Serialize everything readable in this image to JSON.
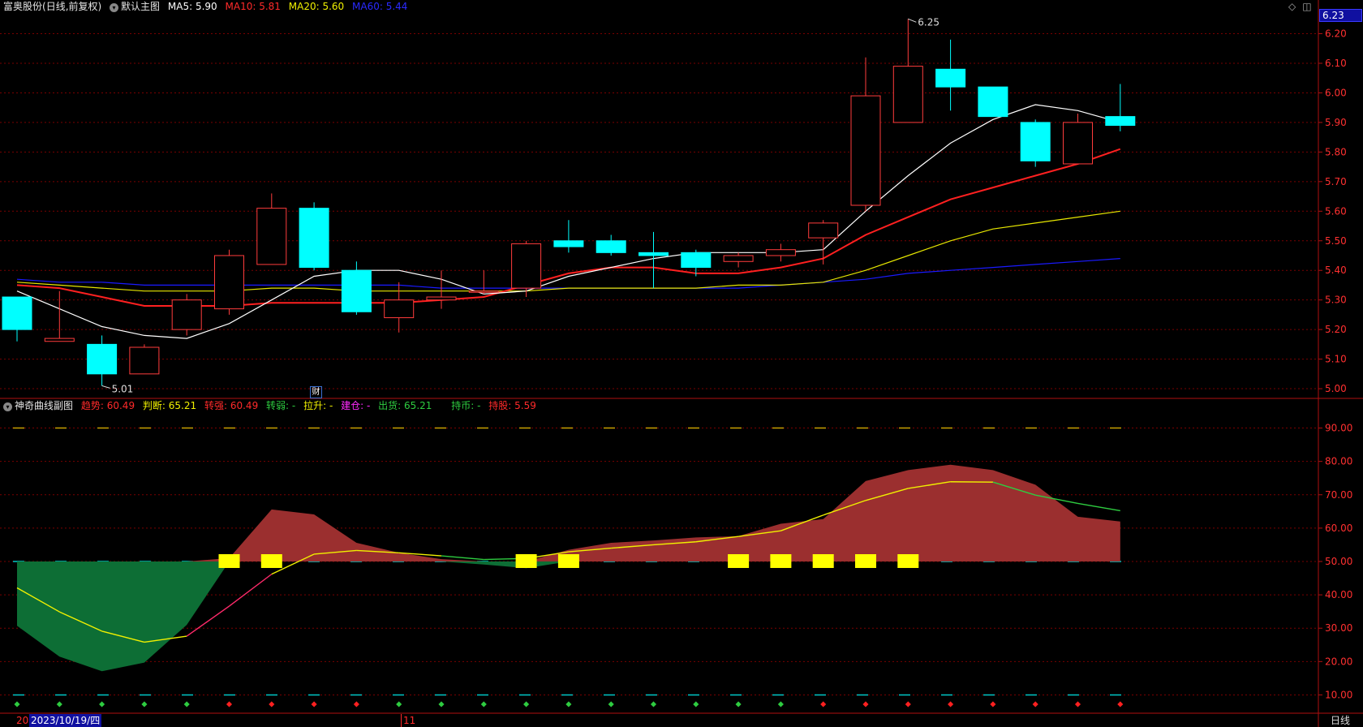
{
  "main_header": {
    "stock": "富奥股份",
    "period": "(日线,前复权)",
    "template": "默认主图",
    "ma5_label": "MA5:",
    "ma5_value": "5.90",
    "ma10_label": "MA10:",
    "ma10_value": "5.81",
    "ma20_label": "MA20:",
    "ma20_value": "5.60",
    "ma60_label": "MA60:",
    "ma60_value": "5.44"
  },
  "sub_header": {
    "title": "神奇曲线副图",
    "trend_label": "趋势:",
    "trend_value": "60.49",
    "judge_label": "判断:",
    "judge_value": "65.21",
    "strong_label": "转强:",
    "strong_value": "60.49",
    "weak_label": "转弱:",
    "weak_value": "-",
    "pull_label": "拉升:",
    "pull_value": "-",
    "build_label": "建仓:",
    "build_value": "-",
    "ship_label": "出货:",
    "ship_value": "65.21",
    "hold_label": "持币:",
    "hold_value": "-",
    "holdstock_label": "持股:",
    "holdstock_value": "5.59"
  },
  "colors": {
    "up": "#ff3c3c",
    "down": "#00ffff",
    "ma5": "#ffffff",
    "ma10": "#ff2020",
    "ma20": "#e6e600",
    "ma60": "#1a1aff",
    "grid": "#8b0000",
    "area_up": "#9b2f2f",
    "area_down": "#0d6e35",
    "marker": "#ffff00"
  },
  "current_price_tag": "6.23",
  "finance_mark": "财",
  "bottom_bar": {
    "year_frag": "20",
    "date": "2023/10/19/四",
    "month": "11",
    "period_button": "日线"
  },
  "chart_data": [
    {
      "type": "candlestick",
      "title": "富奥股份 日线",
      "x": [
        "d1",
        "d2",
        "d3",
        "d4",
        "d5",
        "d6",
        "d7",
        "d8",
        "d9",
        "d10",
        "d11",
        "d12",
        "d13",
        "d14",
        "d15",
        "d16",
        "d17",
        "d18",
        "d19",
        "d20",
        "d21",
        "d22",
        "d23",
        "d24",
        "d25",
        "d26",
        "d27"
      ],
      "candles": [
        {
          "o": 5.31,
          "h": 5.31,
          "l": 5.16,
          "c": 5.2
        },
        {
          "o": 5.16,
          "h": 5.33,
          "l": 5.16,
          "c": 5.17
        },
        {
          "o": 5.15,
          "h": 5.18,
          "l": 5.01,
          "c": 5.05
        },
        {
          "o": 5.05,
          "h": 5.15,
          "l": 5.05,
          "c": 5.14
        },
        {
          "o": 5.2,
          "h": 5.32,
          "l": 5.18,
          "c": 5.3
        },
        {
          "o": 5.27,
          "h": 5.47,
          "l": 5.25,
          "c": 5.45
        },
        {
          "o": 5.42,
          "h": 5.66,
          "l": 5.42,
          "c": 5.61
        },
        {
          "o": 5.61,
          "h": 5.63,
          "l": 5.4,
          "c": 5.41
        },
        {
          "o": 5.4,
          "h": 5.43,
          "l": 5.25,
          "c": 5.26
        },
        {
          "o": 5.24,
          "h": 5.36,
          "l": 5.19,
          "c": 5.3
        },
        {
          "o": 5.3,
          "h": 5.4,
          "l": 5.27,
          "c": 5.31
        },
        {
          "o": 5.33,
          "h": 5.4,
          "l": 5.32,
          "c": 5.33
        },
        {
          "o": 5.34,
          "h": 5.5,
          "l": 5.31,
          "c": 5.49
        },
        {
          "o": 5.5,
          "h": 5.57,
          "l": 5.46,
          "c": 5.48
        },
        {
          "o": 5.5,
          "h": 5.52,
          "l": 5.45,
          "c": 5.46
        },
        {
          "o": 5.46,
          "h": 5.53,
          "l": 5.34,
          "c": 5.45
        },
        {
          "o": 5.46,
          "h": 5.47,
          "l": 5.38,
          "c": 5.41
        },
        {
          "o": 5.43,
          "h": 5.46,
          "l": 5.41,
          "c": 5.45
        },
        {
          "o": 5.45,
          "h": 5.49,
          "l": 5.43,
          "c": 5.47
        },
        {
          "o": 5.51,
          "h": 5.57,
          "l": 5.42,
          "c": 5.56
        },
        {
          "o": 5.62,
          "h": 6.12,
          "l": 5.6,
          "c": 5.99
        },
        {
          "o": 5.9,
          "h": 6.25,
          "l": 5.9,
          "c": 6.09
        },
        {
          "o": 6.08,
          "h": 6.18,
          "l": 5.94,
          "c": 6.02
        },
        {
          "o": 6.02,
          "h": 6.02,
          "l": 5.92,
          "c": 5.92
        },
        {
          "o": 5.9,
          "h": 5.91,
          "l": 5.75,
          "c": 5.77
        },
        {
          "o": 5.76,
          "h": 5.93,
          "l": 5.76,
          "c": 5.9
        },
        {
          "o": 5.92,
          "h": 6.03,
          "l": 5.87,
          "c": 5.89
        }
      ],
      "ma5": [
        5.33,
        5.27,
        5.21,
        5.18,
        5.17,
        5.22,
        5.3,
        5.38,
        5.4,
        5.4,
        5.37,
        5.32,
        5.33,
        5.38,
        5.41,
        5.44,
        5.46,
        5.46,
        5.46,
        5.47,
        5.6,
        5.72,
        5.83,
        5.91,
        5.96,
        5.94,
        5.9
      ],
      "ma10": [
        5.35,
        5.34,
        5.31,
        5.28,
        5.28,
        5.28,
        5.29,
        5.29,
        5.29,
        5.29,
        5.3,
        5.31,
        5.35,
        5.39,
        5.41,
        5.41,
        5.39,
        5.39,
        5.41,
        5.44,
        5.52,
        5.58,
        5.64,
        5.68,
        5.72,
        5.76,
        5.81
      ],
      "ma20": [
        5.36,
        5.35,
        5.34,
        5.33,
        5.33,
        5.33,
        5.34,
        5.34,
        5.33,
        5.33,
        5.33,
        5.33,
        5.33,
        5.34,
        5.34,
        5.34,
        5.34,
        5.35,
        5.35,
        5.36,
        5.4,
        5.45,
        5.5,
        5.54,
        5.56,
        5.58,
        5.6
      ],
      "ma60": [
        5.37,
        5.36,
        5.36,
        5.35,
        5.35,
        5.35,
        5.35,
        5.35,
        5.35,
        5.35,
        5.34,
        5.34,
        5.34,
        5.34,
        5.34,
        5.34,
        5.34,
        5.34,
        5.35,
        5.36,
        5.37,
        5.39,
        5.4,
        5.41,
        5.42,
        5.43,
        5.44
      ],
      "ylim": [
        4.97,
        6.27
      ],
      "y_ticks": [
        "5.00",
        "5.10",
        "5.20",
        "5.30",
        "5.40",
        "5.50",
        "5.60",
        "5.70",
        "5.80",
        "5.90",
        "6.00",
        "6.10",
        "6.20"
      ],
      "annotations": [
        {
          "index": 2,
          "value": 5.01,
          "text": "5.01"
        },
        {
          "index": 21,
          "value": 6.25,
          "text": "6.25"
        }
      ]
    },
    {
      "type": "area",
      "title": "神奇曲线副图",
      "x": [
        "d1",
        "d2",
        "d3",
        "d4",
        "d5",
        "d6",
        "d7",
        "d8",
        "d9",
        "d10",
        "d11",
        "d12",
        "d13",
        "d14",
        "d15",
        "d16",
        "d17",
        "d18",
        "d19",
        "d20",
        "d21",
        "d22",
        "d23",
        "d24",
        "d25",
        "d26",
        "d27"
      ],
      "trend": [
        30.7,
        21.5,
        17.1,
        19.7,
        31.0,
        51.0,
        65.6,
        64.1,
        55.6,
        52.6,
        50.7,
        49.1,
        48.0,
        53.5,
        55.6,
        56.3,
        57.2,
        57.6,
        61.3,
        62.7,
        74.1,
        77.4,
        79.0,
        77.4,
        73.0,
        63.4,
        62.0,
        60.49
      ],
      "judge": [
        42.1,
        34.9,
        29.1,
        25.8,
        27.6,
        36.6,
        46.2,
        52.2,
        53.3,
        52.6,
        51.7,
        50.6,
        50.9,
        52.9,
        54.0,
        55.0,
        55.9,
        57.5,
        59.2,
        63.9,
        68.3,
        71.9,
        73.9,
        73.8,
        69.9,
        67.4,
        65.21
      ],
      "baseline": 50,
      "buy_markers": [
        5,
        6,
        12,
        13,
        17,
        18,
        19,
        20,
        21
      ],
      "dots": [
        "g",
        "g",
        "g",
        "g",
        "g",
        "r",
        "r",
        "r",
        "r",
        "g",
        "g",
        "g",
        "g",
        "g",
        "g",
        "g",
        "g",
        "g",
        "g",
        "r",
        "r",
        "r",
        "r",
        "r",
        "r",
        "r",
        "r"
      ],
      "ylim": [
        5,
        95
      ],
      "y_ticks": [
        "10.00",
        "20.00",
        "30.00",
        "40.00",
        "50.00",
        "60.00",
        "70.00",
        "80.00",
        "90.00"
      ],
      "ref_lines": [
        90,
        50,
        10
      ]
    }
  ]
}
